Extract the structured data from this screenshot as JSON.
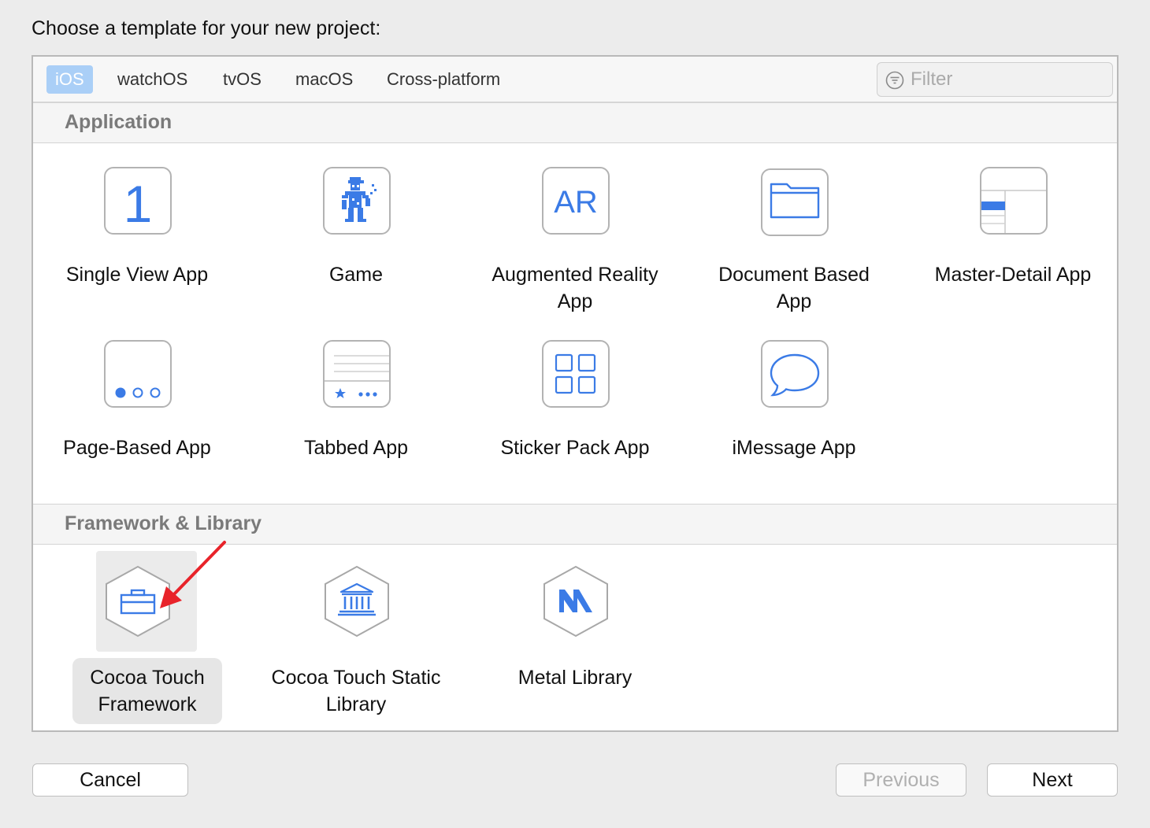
{
  "title": "Choose a template for your new project:",
  "tabs": [
    {
      "label": "iOS",
      "selected": true
    },
    {
      "label": "watchOS"
    },
    {
      "label": "tvOS"
    },
    {
      "label": "macOS"
    },
    {
      "label": "Cross-platform"
    }
  ],
  "filter": {
    "placeholder": "Filter"
  },
  "sections": [
    {
      "title": "Application",
      "items": [
        {
          "label": "Single View App",
          "icon": "single-view-app-icon"
        },
        {
          "label": "Game",
          "icon": "game-icon"
        },
        {
          "label": "Augmented Reality App",
          "icon": "ar-icon",
          "glyph": "AR"
        },
        {
          "label": "Document Based App",
          "icon": "folder-icon"
        },
        {
          "label": "Master-Detail App",
          "icon": "master-detail-icon"
        },
        {
          "label": "Page-Based App",
          "icon": "page-dots-icon"
        },
        {
          "label": "Tabbed App",
          "icon": "tab-bar-icon"
        },
        {
          "label": "Sticker Pack App",
          "icon": "sticker-grid-icon"
        },
        {
          "label": "iMessage App",
          "icon": "speech-bubble-icon"
        }
      ]
    },
    {
      "title": "Framework & Library",
      "items": [
        {
          "label": "Cocoa Touch Framework",
          "icon": "toolbox-icon",
          "selected": true
        },
        {
          "label": "Cocoa Touch Static Library",
          "icon": "library-building-icon"
        },
        {
          "label": "Metal Library",
          "icon": "metal-icon"
        }
      ]
    }
  ],
  "buttons": {
    "cancel": "Cancel",
    "previous": "Previous",
    "next": "Next"
  },
  "colors": {
    "accent": "#3b7be6",
    "tab_selected_bg": "#aacff7",
    "annotation_arrow": "#e8232a"
  }
}
